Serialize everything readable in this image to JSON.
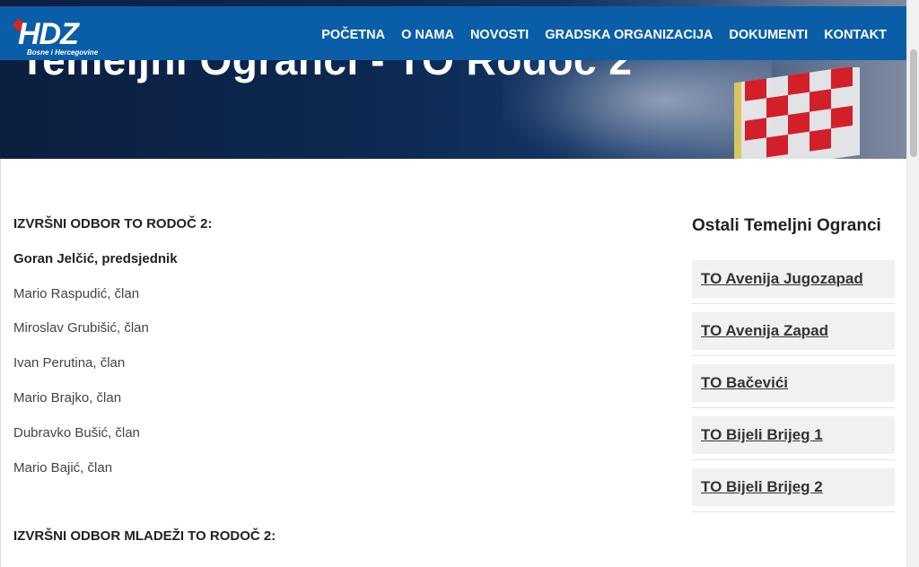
{
  "logo": {
    "text": "HDZ",
    "subtitle": "Bosne i Hercegovine"
  },
  "nav": {
    "items": [
      "POČETNA",
      "O NAMA",
      "NOVOSTI",
      "GRADSKA ORGANIZACIJA",
      "DOKUMENTI",
      "KONTAKT"
    ]
  },
  "hero": {
    "title": "Temeljni Ogranci - TO Rodoč 2"
  },
  "main": {
    "heading1": "IZVRŠNI ODBOR TO RODOČ 2:",
    "president": "Goran  Jelčić, predsjednik",
    "members": [
      "Mario Raspudić, član",
      "Miroslav Grubišić, član",
      "Ivan Perutina, član",
      "Mario Brajko, član",
      "Dubravko Bušić, član",
      "Mario Bajić, član"
    ],
    "heading2": "IZVRŠNI ODBOR MLADEŽI TO RODOČ 2:"
  },
  "sidebar": {
    "title": "Ostali Temeljni Ogranci",
    "items": [
      "TO Avenija Jugozapad",
      "TO Avenija Zapad",
      "TO Bačevići",
      "TO Bijeli Brijeg 1",
      "TO Bijeli Brijeg 2"
    ]
  },
  "colors": {
    "navbar": "#0a5ea8",
    "hero_dark": "#0b1f3f",
    "sidebar_item_bg": "#f1f1f1",
    "logo_diamond": "#e32119"
  }
}
